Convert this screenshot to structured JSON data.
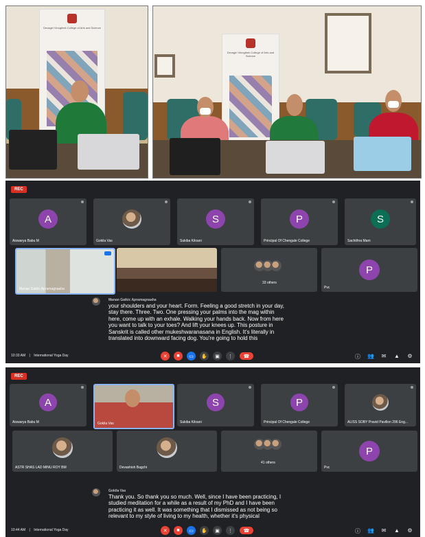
{
  "photos": {
    "banner_left": "Devagiri Vinogthek College of Arts and Science",
    "banner_right": "Devagiri Vinogthek College of Arts and Science"
  },
  "meet1": {
    "rec_label": "REC",
    "participants": [
      {
        "initial": "A",
        "name": "Aiswarya Babu M",
        "color": "#8e44ad"
      },
      {
        "initial": "",
        "name": "Gokila Vas",
        "color": ""
      },
      {
        "initial": "S",
        "name": "Sukiba Kiloani",
        "color": "#8e44ad"
      },
      {
        "initial": "P",
        "name": "Principal Of Chengale College",
        "color": "#8e44ad"
      },
      {
        "initial": "S",
        "name": "Sachithra Mam",
        "color": "#0b6e55"
      }
    ],
    "video_tiles": [
      {
        "name": "Manan Gaikic Apramagnaaha"
      },
      {
        "name": ""
      }
    ],
    "others_label": "33 others",
    "p_tile": {
      "initial": "P",
      "name": "Pvc",
      "color": "#8e44ad"
    },
    "caption_speaker": "Manan Gaikic Apramagnaaha",
    "caption_lines": [
      "your shoulders and your heart. Form. Feeling a good stretch in your day,",
      "stay there. Three. Two. One pressing your palms into the mag within",
      "here, come up with an exhale. Walking your hands back. Now from here",
      "you want to talk to your toes? And lift your knees up. This posture in",
      "Sanskrit is called other mukeshwaranasana in English. It's literally in",
      "translated into downward facing dog. You're going to hold this"
    ],
    "time": "10:33 AM",
    "meeting_name": "International Yoga Day"
  },
  "meet2": {
    "rec_label": "REC",
    "row1": [
      {
        "initial": "A",
        "name": "Aiswarya Babu M",
        "color": "#8e44ad"
      },
      {
        "initial": "",
        "name": "Gokila Vas",
        "color": ""
      },
      {
        "initial": "S",
        "name": "Sukiba Kiloani",
        "color": "#8e44ad"
      },
      {
        "initial": "P",
        "name": "Principal Of Chengale College",
        "color": "#8e44ad"
      },
      {
        "initial": "",
        "name": "ALISS SOBY Pravid Pavillon 296 Eng...",
        "color": ""
      }
    ],
    "row2": [
      {
        "name": "ASTR SHAS LAD MINU ROY BM"
      },
      {
        "name": "Devashish Bagchi"
      },
      {
        "name": "41 others"
      },
      {
        "initial": "P",
        "name": "Pvc",
        "color": "#8e44ad"
      }
    ],
    "caption_speaker": "Gokila Vas",
    "caption_lines": [
      "Thank you. So thank you so much. Well, since I have been practicing, I",
      "studied meditation for a while as a result of my PhD and I have been",
      "practicing it as well. It was something that I dismissed as not being so",
      "relevant to my style of living to my health, whether it's physical"
    ],
    "time": "10:44 AM",
    "meeting_name": "International Yoga Day"
  },
  "icons": {
    "mic": "mic-off-icon",
    "camera": "camera-off-icon",
    "captions": "captions-icon",
    "hand": "raise-hand-icon",
    "present": "present-icon",
    "more": "more-icon",
    "end": "end-call-icon",
    "info": "info-icon",
    "people": "people-icon",
    "chat": "chat-icon",
    "activities": "activities-icon",
    "lock": "host-controls-icon"
  }
}
